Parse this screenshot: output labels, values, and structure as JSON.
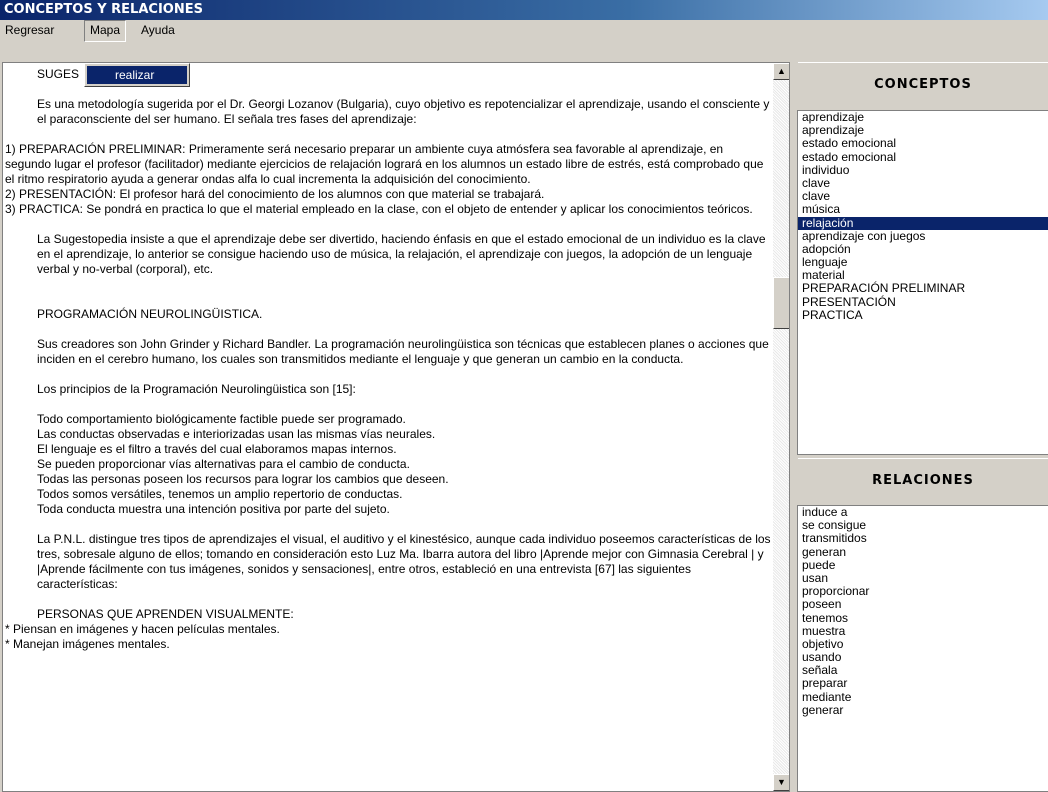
{
  "window": {
    "title": "CONCEPTOS Y RELACIONES"
  },
  "menu": {
    "items": [
      "Regresar",
      "Mapa",
      "Ayuda"
    ],
    "open_menu": "Mapa",
    "dropdown_items": [
      "realizar"
    ]
  },
  "document": {
    "paragraphs": [
      {
        "text": "SUGES",
        "indent": true
      },
      {
        "text": "",
        "indent": false
      },
      {
        "text": "Es una metodología sugerida por el Dr. Georgi Lozanov (Bulgaria), cuyo objetivo es repotencializar el aprendizaje, usando el consciente y el paraconsciente del ser humano. El señala tres fases del aprendizaje:",
        "indent": true
      },
      {
        "text": "",
        "indent": false
      },
      {
        "text": "1) PREPARACIÓN PRELIMINAR: Primeramente será necesario preparar un ambiente cuya atmósfera sea favorable al aprendizaje, en segundo lugar el profesor (facilitador) mediante ejercicios de relajación logrará en los alumnos un estado libre de estrés, está comprobado que el ritmo respiratorio ayuda a generar ondas alfa lo cual incrementa la adquisición del conocimiento.",
        "indent": false
      },
      {
        "text": "2) PRESENTACIÓN: El profesor hará del conocimiento de los alumnos con que material se trabajará.",
        "indent": false
      },
      {
        "text": "3) PRACTICA: Se pondrá en practica lo que el material empleado en la clase, con el objeto de entender y aplicar los conocimientos teóricos.",
        "indent": false
      },
      {
        "text": "",
        "indent": false
      },
      {
        "text": "La Sugestopedia insiste a que el aprendizaje debe ser divertido, haciendo énfasis en que el estado emocional de un individuo es la clave en el aprendizaje, lo anterior se consigue haciendo uso de música, la relajación, el aprendizaje con juegos, la adopción de un lenguaje verbal y no-verbal (corporal), etc.",
        "indent": true
      },
      {
        "text": "",
        "indent": false
      },
      {
        "text": "",
        "indent": false
      },
      {
        "text": "PROGRAMACIÓN NEUROLINGÜISTICA.",
        "indent": true
      },
      {
        "text": "",
        "indent": false
      },
      {
        "text": "Sus creadores son John Grinder y Richard Bandler. La programación neurolingüistica son técnicas que establecen planes o acciones que inciden en el cerebro humano, los cuales son transmitidos mediante el lenguaje y que generan un cambio en la conducta.",
        "indent": true
      },
      {
        "text": "",
        "indent": false
      },
      {
        "text": "Los principios de la Programación Neurolingüistica son [15]:",
        "indent": true
      },
      {
        "text": "",
        "indent": false
      },
      {
        "text": "Todo comportamiento biológicamente factible puede ser programado.",
        "indent": true
      },
      {
        "text": "Las conductas observadas e interiorizadas usan las mismas vías neurales.",
        "indent": true
      },
      {
        "text": "El lenguaje es el filtro a través del cual elaboramos mapas internos.",
        "indent": true
      },
      {
        "text": "Se pueden proporcionar vías alternativas para el cambio de conducta.",
        "indent": true
      },
      {
        "text": "Todas las personas poseen los recursos para lograr los cambios que deseen.",
        "indent": true
      },
      {
        "text": "Todos somos versátiles, tenemos un amplio repertorio de conductas.",
        "indent": true
      },
      {
        "text": "Toda conducta muestra una intención positiva por parte del sujeto.",
        "indent": true
      },
      {
        "text": "",
        "indent": false
      },
      {
        "text": "La P.N.L. distingue tres tipos de aprendizajes el visual, el auditivo y el kinestésico, aunque cada individuo poseemos características de los tres, sobresale alguno de ellos; tomando en consideración esto Luz Ma. Ibarra autora del libro |Aprende mejor con Gimnasia Cerebral | y |Aprende fácilmente con tus imágenes, sonidos y sensaciones|, entre otros, estableció en una entrevista [67] las siguientes características:",
        "indent": true
      },
      {
        "text": "",
        "indent": false
      },
      {
        "text": "PERSONAS QUE APRENDEN VISUALMENTE:",
        "indent": true
      },
      {
        "text": "* Piensan en imágenes y hacen películas mentales.",
        "indent": false
      },
      {
        "text": "* Manejan imágenes mentales.",
        "indent": false
      }
    ]
  },
  "conceptos": {
    "header": "CONCEPTOS",
    "selected_index": 8,
    "items": [
      "aprendizaje",
      "aprendizaje",
      "estado emocional",
      "estado emocional",
      "individuo",
      "clave",
      "clave",
      "música",
      "relajación",
      "aprendizaje con juegos",
      "adopción",
      "lenguaje",
      "material",
      "PREPARACIÓN PRELIMINAR",
      "PRESENTACIÓN",
      "PRACTICA"
    ]
  },
  "relaciones": {
    "header": "RELACIONES",
    "items": [
      "induce a",
      "se consigue",
      "transmitidos",
      "generan",
      "puede",
      "usan",
      "proporcionar",
      "poseen",
      "tenemos",
      "muestra",
      "objetivo",
      "usando",
      "señala",
      "preparar",
      "mediante",
      "generar"
    ]
  },
  "scrollbar": {
    "up_arrow": "▲",
    "down_arrow": "▼"
  }
}
